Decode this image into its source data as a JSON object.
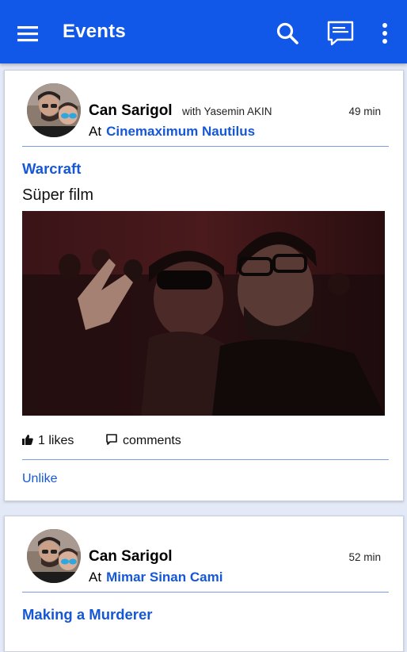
{
  "appbar": {
    "title": "Events",
    "color": "#1157e8"
  },
  "posts": [
    {
      "author": "Can Sarigol",
      "with_text": "with Yasemin AKIN",
      "time": "49 min",
      "at_label": "At",
      "place": "Cinemaximum Nautilus",
      "event_title": "Warcraft",
      "text": "Süper film",
      "likes": "1 likes",
      "comments": "comments",
      "action": "Unlike"
    },
    {
      "author": "Can Sarigol",
      "time": "52 min",
      "at_label": "At",
      "place": "Mimar Sinan Cami",
      "event_title": "Making a Murderer"
    }
  ],
  "icons": {
    "menu": "menu-icon",
    "search": "search-icon",
    "chat": "chat-icon",
    "more": "more-vert-icon",
    "like": "thumb-up-icon",
    "comment": "comment-icon"
  },
  "accent_color": "#1557d6"
}
